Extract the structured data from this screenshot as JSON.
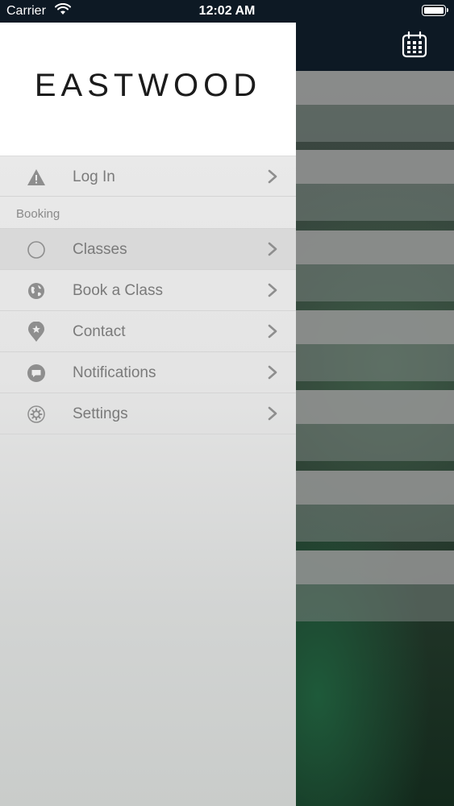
{
  "status_bar": {
    "carrier": "Carrier",
    "time": "12:02 AM"
  },
  "header": {
    "calendar_icon": "calendar-icon"
  },
  "drawer": {
    "brand": "EASTWOOD",
    "login": {
      "label": "Log In",
      "icon": "warning-icon"
    },
    "section_label": "Booking",
    "items": [
      {
        "label": "Classes",
        "icon": "circle-icon",
        "active": true
      },
      {
        "label": "Book a Class",
        "icon": "globe-icon"
      },
      {
        "label": "Contact",
        "icon": "map-pin-icon"
      },
      {
        "label": "Notifications",
        "icon": "chat-icon"
      },
      {
        "label": "Settings",
        "icon": "gear-icon"
      }
    ]
  },
  "colors": {
    "header_bg": "#0d1924",
    "drawer_bg": "#ececec",
    "menu_text": "#7a7a7a",
    "icon": "#8e8e8e"
  }
}
